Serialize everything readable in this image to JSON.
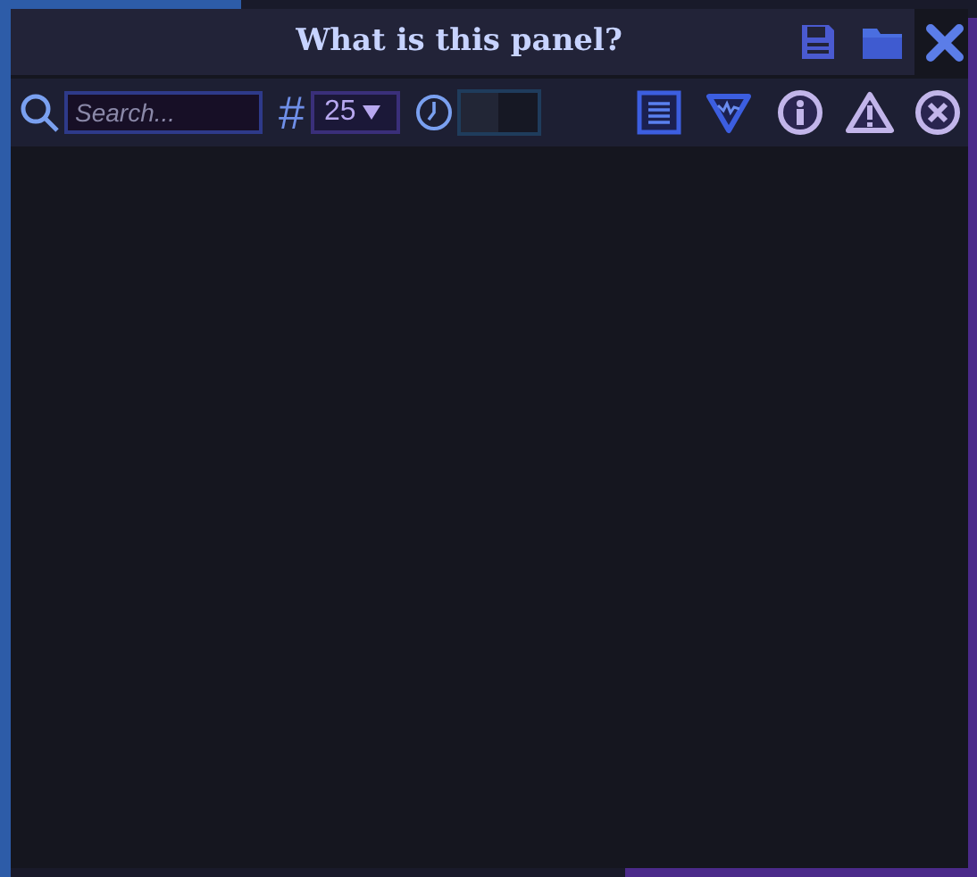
{
  "window": {
    "title": "What is this panel?"
  },
  "toolbar": {
    "search": {
      "placeholder": "Search..."
    },
    "count_symbol": "#",
    "page_size": {
      "value": "25"
    },
    "timer_toggle": {
      "on": false
    }
  }
}
